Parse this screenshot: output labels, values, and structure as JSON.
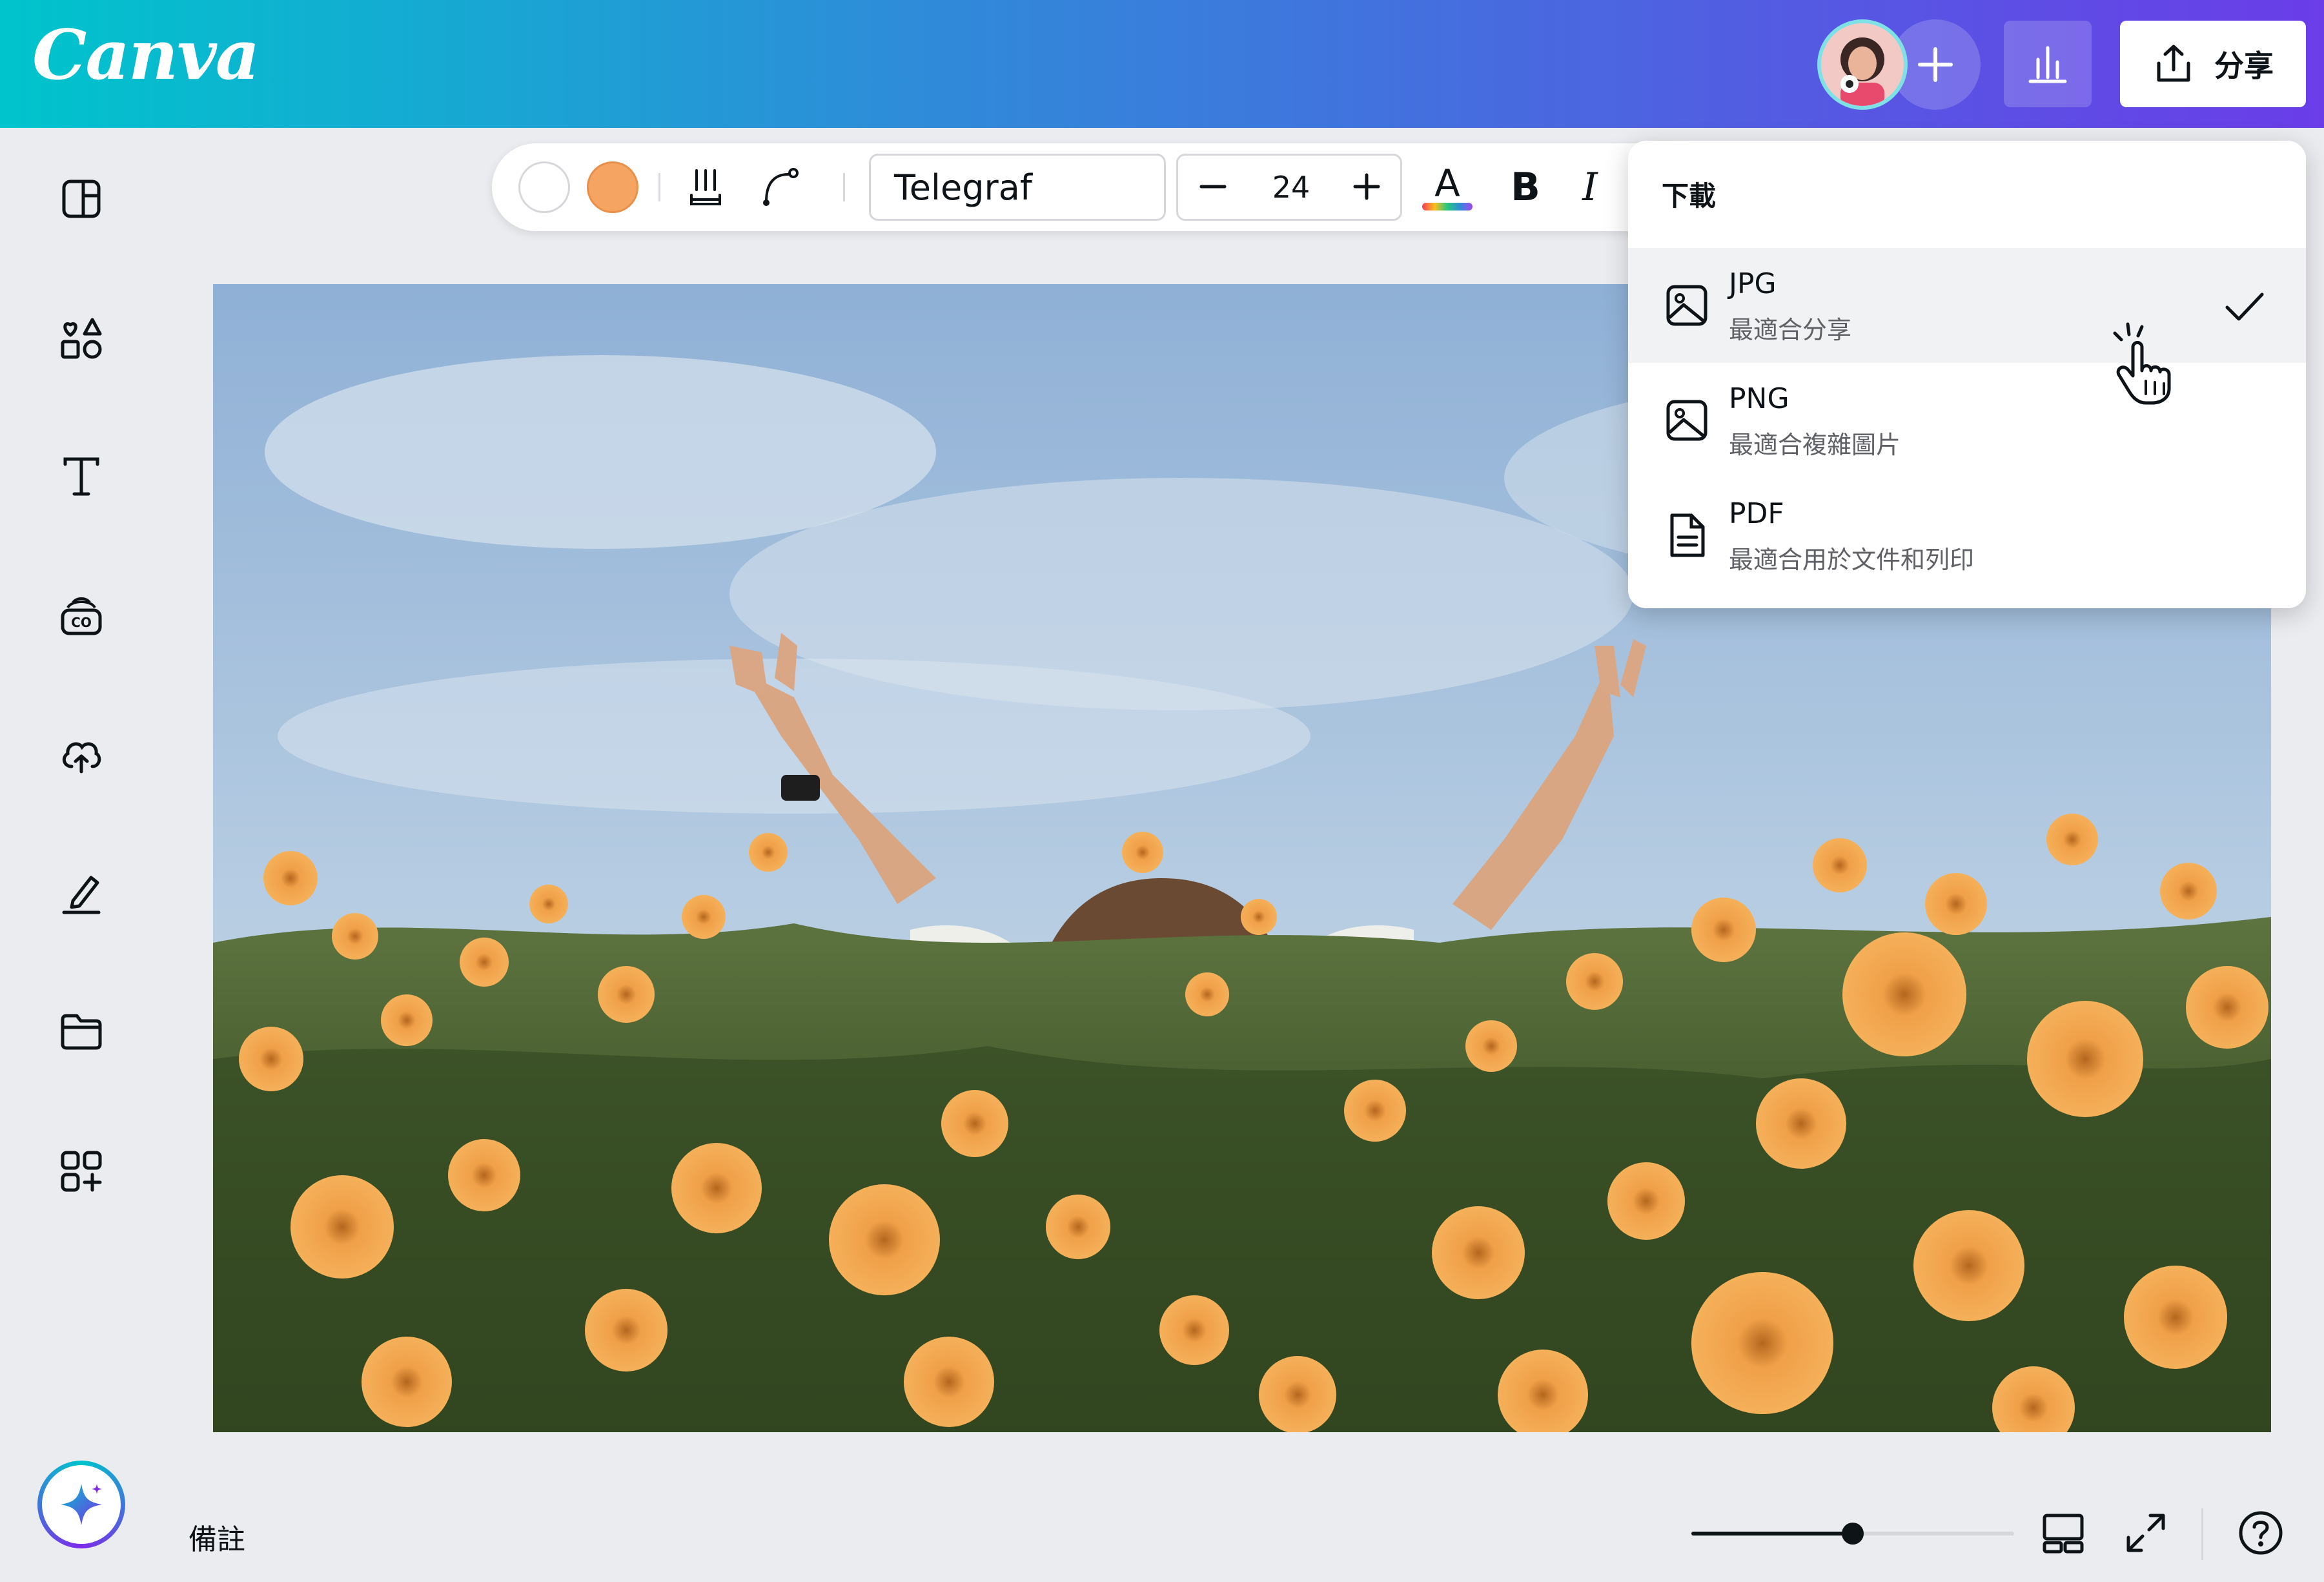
{
  "app": {
    "logo": "Canva"
  },
  "header": {
    "share_label": "分享"
  },
  "sidebar": {
    "items": [
      {
        "icon": "layout-icon"
      },
      {
        "icon": "elements-icon"
      },
      {
        "icon": "text-icon"
      },
      {
        "icon": "brand-icon"
      },
      {
        "icon": "uploads-icon"
      },
      {
        "icon": "draw-icon"
      },
      {
        "icon": "projects-icon"
      },
      {
        "icon": "apps-icon"
      }
    ]
  },
  "toolbar": {
    "color_swatches": [
      "#ffffff",
      "#f5a462"
    ],
    "font_name": "Telegraf",
    "font_size": "24",
    "bold_label": "B",
    "italic_label": "I",
    "text_color_letter": "A"
  },
  "download_menu": {
    "title": "下載",
    "options": [
      {
        "label": "JPG",
        "description": "最適合分享",
        "selected": true,
        "icon": "image-icon"
      },
      {
        "label": "PNG",
        "description": "最適合複雜圖片",
        "selected": false,
        "icon": "image-icon"
      },
      {
        "label": "PDF",
        "description": "最適合用於文件和列印",
        "selected": false,
        "icon": "document-icon"
      }
    ]
  },
  "footer": {
    "notes_label": "備註",
    "zoom_level": 0.5
  },
  "colors": {
    "accent": "#7d2ae8",
    "brand_teal": "#00c4cc",
    "swatch_orange": "#f5a462"
  }
}
